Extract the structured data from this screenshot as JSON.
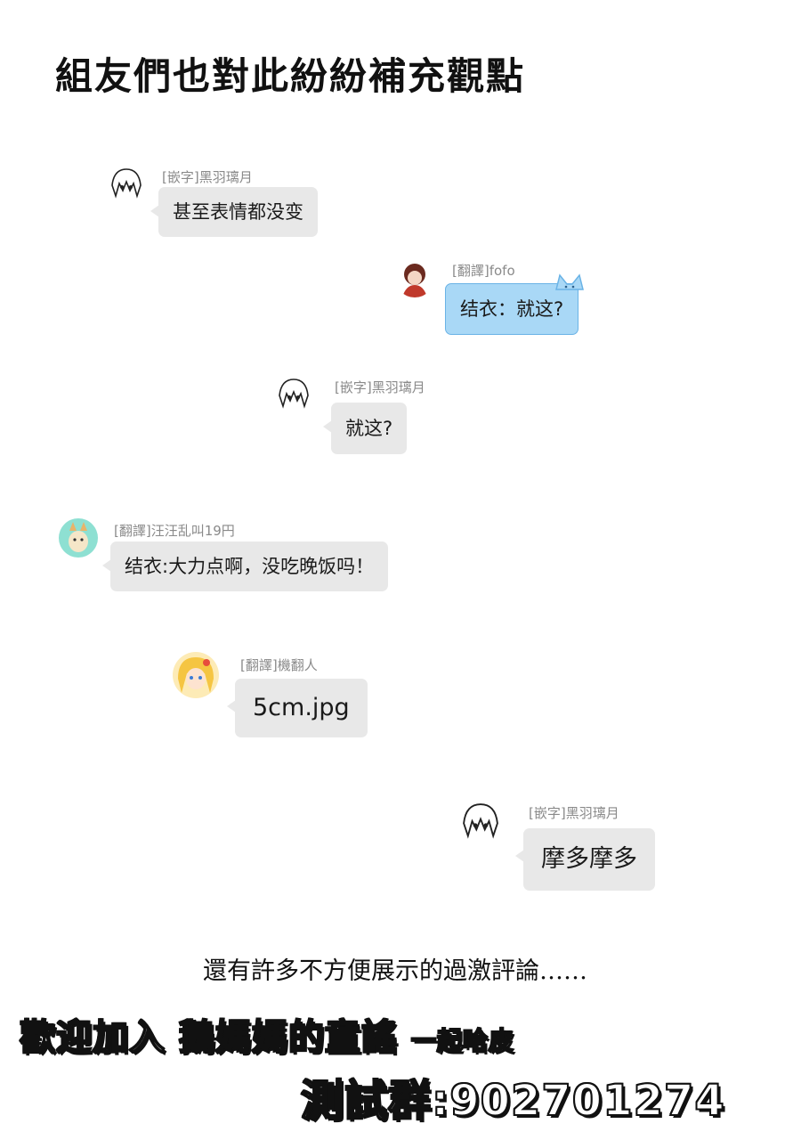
{
  "page": {
    "title": "組友們也對此紛紛補充觀點",
    "footer_note": "還有許多不方便展示的過激評論……",
    "banner_line1_a": "歡迎加入 鵝媽媽的童謠",
    "banner_line1_b": "一起哈皮",
    "banner_line2": "測試群:902701274"
  },
  "messages": [
    {
      "name": "[嵌字]黑羽璃月",
      "text": "甚至表情都没变",
      "avatar": "sketch-girl-avatar"
    },
    {
      "name": "[翻譯]fofo",
      "text": "结衣：就这?",
      "avatar": "red-hair-avatar",
      "style": "blue-cat-bubble"
    },
    {
      "name": "[嵌字]黑羽璃月",
      "text": "就这?",
      "avatar": "sketch-girl-avatar"
    },
    {
      "name": "[翻譯]汪汪乱叫19円",
      "text": "结衣:大力点啊，没吃晚饭吗！",
      "avatar": "teal-fox-avatar"
    },
    {
      "name": "[翻譯]機翻人",
      "text": "5cm.jpg",
      "avatar": "blonde-girl-avatar"
    },
    {
      "name": "[嵌字]黑羽璃月",
      "text": "摩多摩多",
      "avatar": "sketch-girl-avatar"
    }
  ],
  "colors": {
    "bubble_gray": "#e8e8e8",
    "bubble_blue": "#a9d8f6",
    "name_gray": "#8a8a8a"
  }
}
